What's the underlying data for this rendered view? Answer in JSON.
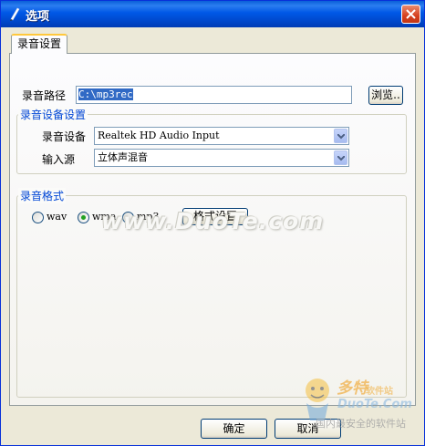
{
  "window": {
    "title": "选项"
  },
  "tabs": [
    {
      "label": "录音设置"
    }
  ],
  "record_path": {
    "label": "录音路径",
    "value": "C:\\mp3rec",
    "browse_label": "浏览.."
  },
  "device_group": {
    "title": "录音设备设置",
    "device_label": "录音设备",
    "device_value": "Realtek HD Audio Input",
    "source_label": "输入源",
    "source_value": "立体声混音"
  },
  "format_group": {
    "title": "录音格式",
    "options": [
      {
        "label": "wav",
        "selected": false
      },
      {
        "label": "wma",
        "selected": true
      },
      {
        "label": "mp3",
        "selected": false
      }
    ],
    "settings_label": "格式设置"
  },
  "footer": {
    "ok_label": "确定",
    "cancel_label": "取消"
  },
  "watermark": {
    "site": "www.DuoTe.com",
    "logo_cn": "多特",
    "logo_small": "软件站",
    "logo_en": "DuoTe.Com",
    "slogan": "国内最安全的软件站"
  },
  "colors": {
    "title_bar": "#0058e6",
    "group_title": "#0046d5",
    "selection": "#316ac5",
    "tab_highlight": "#ffc83c"
  }
}
